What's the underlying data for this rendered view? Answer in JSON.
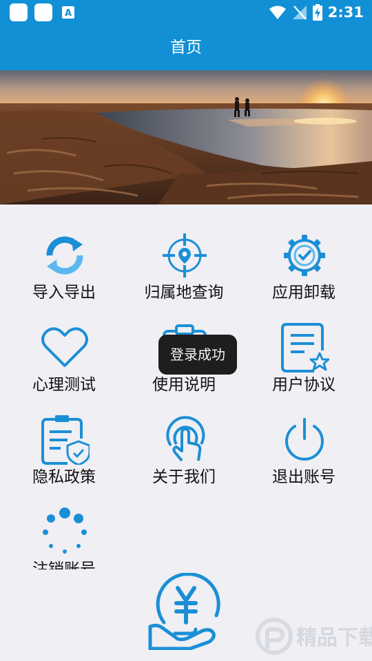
{
  "status_bar": {
    "time": "2:31"
  },
  "app_bar": {
    "title": "首页"
  },
  "grid": {
    "items": [
      {
        "label": "导入导出",
        "icon": "sync-arrows-icon"
      },
      {
        "label": "归属地查询",
        "icon": "location-target-icon"
      },
      {
        "label": "应用卸载",
        "icon": "gear-check-icon"
      },
      {
        "label": "心理测试",
        "icon": "heart-icon"
      },
      {
        "label": "使用说明",
        "icon": "clipboard-icon"
      },
      {
        "label": "用户协议",
        "icon": "document-star-icon"
      },
      {
        "label": "隐私政策",
        "icon": "document-shield-icon"
      },
      {
        "label": "关于我们",
        "icon": "tap-finger-icon"
      },
      {
        "label": "退出账号",
        "icon": "power-icon"
      },
      {
        "label": "注销账号",
        "icon": "loading-dots-icon"
      }
    ]
  },
  "toast": {
    "message": "登录成功"
  },
  "bottom": {
    "icon": "hand-yen-coin-icon"
  },
  "watermark": {
    "text": "精品下载"
  },
  "colors": {
    "primary": "#1190d6",
    "icon": "#1b8fd6",
    "background": "#efeff4"
  }
}
